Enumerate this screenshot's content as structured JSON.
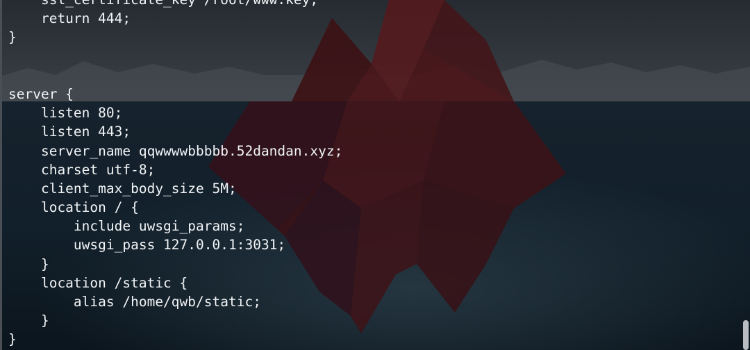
{
  "terminal": {
    "lines": [
      "    ssl_certificate_key /root/www.key;",
      "    return 444;",
      "}",
      "",
      "",
      "server {",
      "    listen 80;",
      "    listen 443;",
      "    server_name qqwwwwbbbbb.52dandan.xyz;",
      "    charset utf-8;",
      "    client_max_body_size 5M;",
      "    location / {",
      "        include uwsgi_params;",
      "        uwsgi_pass 127.0.0.1:3031;",
      "    }",
      "    location /static {",
      "        alias /home/qwb/static;",
      "    }",
      "}"
    ]
  },
  "theme": {
    "text_color": "#f2f4f6",
    "background_sky": "#2c3238",
    "background_water": "#0e1a24",
    "iceberg_color": "#4a1416",
    "scrollbar_color": "#b9bcc0"
  },
  "wallpaper": {
    "icon": "iceberg-wallpaper"
  }
}
